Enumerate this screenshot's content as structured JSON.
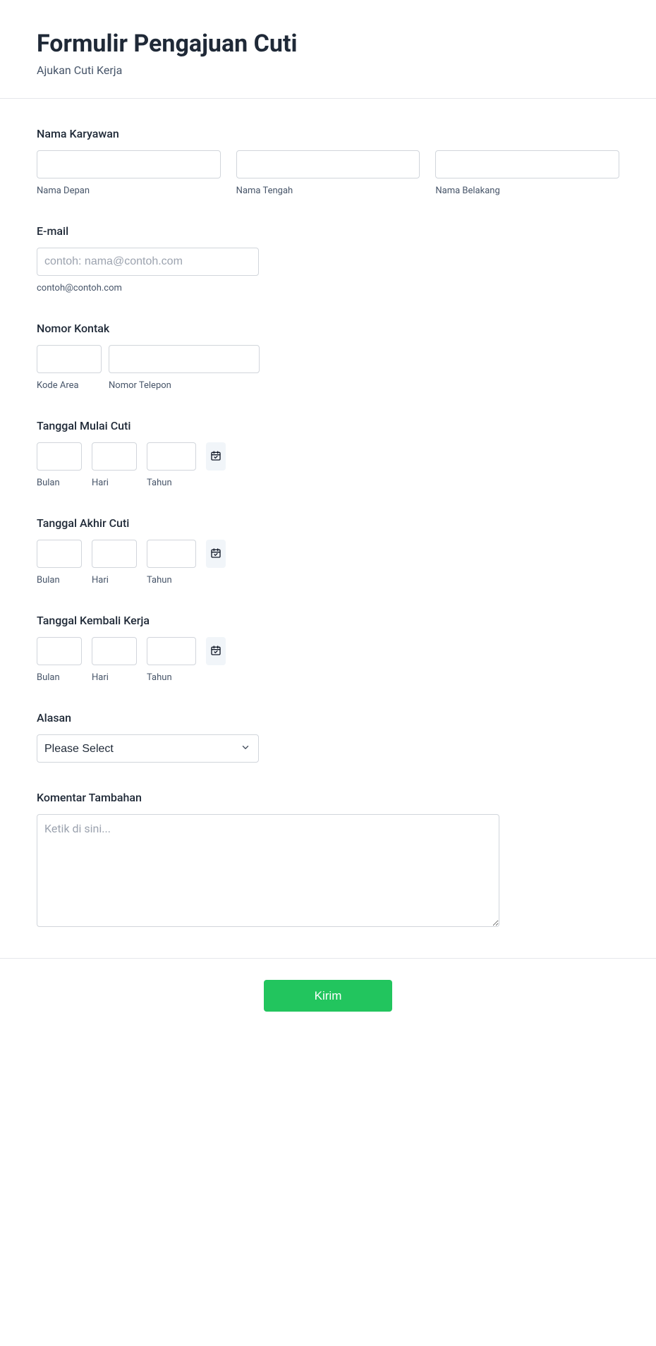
{
  "header": {
    "title": "Formulir Pengajuan Cuti",
    "subtitle": "Ajukan Cuti Kerja"
  },
  "employee_name": {
    "label": "Nama Karyawan",
    "first_sublabel": "Nama Depan",
    "middle_sublabel": "Nama Tengah",
    "last_sublabel": "Nama Belakang"
  },
  "email": {
    "label": "E-mail",
    "placeholder": "contoh: nama@contoh.com",
    "helper": "contoh@contoh.com"
  },
  "phone": {
    "label": "Nomor Kontak",
    "area_sublabel": "Kode Area",
    "number_sublabel": "Nomor Telepon"
  },
  "leave_start": {
    "label": "Tanggal Mulai Cuti",
    "month_sublabel": "Bulan",
    "day_sublabel": "Hari",
    "year_sublabel": "Tahun"
  },
  "leave_end": {
    "label": "Tanggal Akhir Cuti",
    "month_sublabel": "Bulan",
    "day_sublabel": "Hari",
    "year_sublabel": "Tahun"
  },
  "return_date": {
    "label": "Tanggal Kembali Kerja",
    "month_sublabel": "Bulan",
    "day_sublabel": "Hari",
    "year_sublabel": "Tahun"
  },
  "reason": {
    "label": "Alasan",
    "selected": "Please Select"
  },
  "comments": {
    "label": "Komentar Tambahan",
    "placeholder": "Ketik di sini..."
  },
  "submit": {
    "label": "Kirim"
  }
}
